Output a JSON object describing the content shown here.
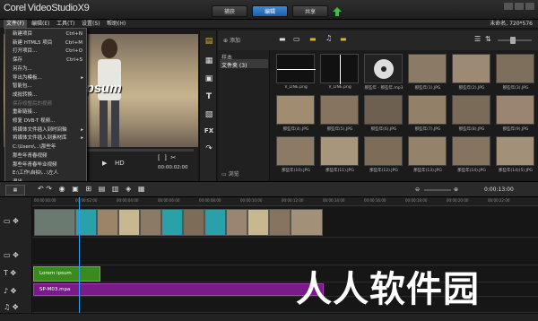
{
  "app": {
    "logo_corel": "Corel",
    "logo_product": "VideoStudioX9",
    "step_tabs": [
      "捕获",
      "编辑",
      "共享"
    ],
    "project_info": "未命名, 720*576"
  },
  "menubar": {
    "items": [
      "文件(F)",
      "编辑(E)",
      "工具(T)",
      "设置(S)",
      "帮助(H)"
    ]
  },
  "file_menu": {
    "items": [
      {
        "label": "新建项目",
        "shortcut": "Ctrl+N"
      },
      {
        "label": "新建 HTML5 项目",
        "shortcut": "Ctrl+M"
      },
      {
        "label": "打开项目...",
        "shortcut": "Ctrl+O"
      },
      {
        "label": "保存",
        "shortcut": "Ctrl+S"
      },
      {
        "label": "另存为...",
        "shortcut": ""
      },
      {
        "label": "导出为模板...",
        "shortcut": ""
      },
      {
        "label": "智能包...",
        "shortcut": ""
      },
      {
        "label": "成批转换...",
        "shortcut": ""
      },
      {
        "label": "保存修整后的视频",
        "shortcut": ""
      },
      {
        "label": "重新链接...",
        "shortcut": ""
      },
      {
        "label": "修复 DVB-T 视频...",
        "shortcut": ""
      },
      {
        "label": "将媒体文件插入到时间轴",
        "shortcut": ""
      },
      {
        "label": "将媒体文件插入到素材库",
        "shortcut": ""
      },
      {
        "label": "C:\\Users\\...\\那些年",
        "shortcut": ""
      },
      {
        "label": "那些年青春视频",
        "shortcut": ""
      },
      {
        "label": "那些年青春毕业视频",
        "shortcut": ""
      },
      {
        "label": "E:\\工作\\自拍\\...\\左人",
        "shortcut": ""
      },
      {
        "label": "退出",
        "shortcut": ""
      }
    ]
  },
  "preview": {
    "overlay_text": "m ipsum",
    "timecode": "00:00:02:00"
  },
  "library": {
    "add_label": "添加",
    "folders": [
      "样本",
      "文件夹 (3)"
    ],
    "thumbs": [
      "V_LINE.png",
      "V_LINE.png",
      "那些年 - 那些年.mp3",
      "那些年(1).JPG",
      "那些年(2).JPG",
      "那些年(3).JPG",
      "那些年(4).JPG",
      "那些年(5).JPG",
      "那些年(6).JPG",
      "那些年(7).JPG",
      "那些年(8).JPG",
      "那些年(9).JPG",
      "那些年(10).JPG",
      "那些年(11).JPG",
      "那些年(12).JPG",
      "那些年(13).JPG",
      "那些年(14).JPG",
      "那些年(14)(5).JPG"
    ],
    "browse_label": "浏览"
  },
  "timeline": {
    "timecode": "0:00:13:00",
    "ruler_ticks": [
      "00:00:00:00",
      "00:00:02:00",
      "00:00:04:00",
      "00:00:06:00",
      "00:00:08:00",
      "00:00:10:00",
      "00:00:12:00",
      "00:00:14:00",
      "00:00:16:00",
      "00:00:18:00",
      "00:00:20:00",
      "00:00:22:00"
    ],
    "title_clip": "Lorem ipsum",
    "music_clip": "SP-M03.mpa"
  },
  "watermark": "人人软件园",
  "colors": {
    "accent_blue": "#2f7fd0",
    "title_clip": "#3b8a1e",
    "music_clip": "#7b1a8a",
    "playhead": "#2aa0ff"
  }
}
